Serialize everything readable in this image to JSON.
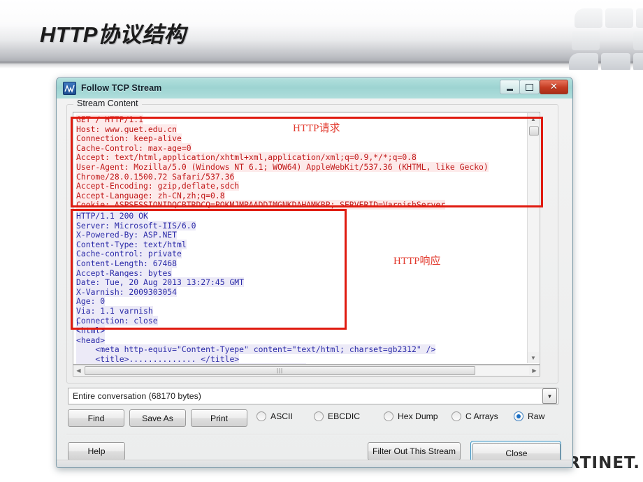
{
  "slide": {
    "title": "HTTP协议结构",
    "watermark": "RTINET."
  },
  "window": {
    "title": "Follow TCP Stream",
    "icon": "wireshark-icon",
    "controls": {
      "minimize": "–",
      "maximize": "□",
      "close": "✕"
    }
  },
  "stream_group": {
    "legend": "Stream Content",
    "scroll": {
      "up_arrow": "▲",
      "down_arrow": "▼",
      "left_arrow": "◀",
      "right_arrow": "▶",
      "grip": "‖‖"
    }
  },
  "request": {
    "lines": "GET / HTTP/1.1\nHost: www.guet.edu.cn\nConnection: keep-alive\nCache-Control: max-age=0\nAccept: text/html,application/xhtml+xml,application/xml;q=0.9,*/*;q=0.8\nUser-Agent: Mozilla/5.0 (Windows NT 6.1; WOW64) AppleWebKit/537.36 (KHTML, like Gecko)\nChrome/28.0.1500.72 Safari/537.36\nAccept-Encoding: gzip,deflate,sdch\nAccept-Language: zh-CN,zh;q=0.8\nCookie: ASPSESSIONIDQCBTRDCQ=POKMJMPAADDIMGNKDAHAMKBP; SERVERID=VarnishServer",
    "annotation": "HTTP请求",
    "color": "#c01717"
  },
  "response": {
    "lines": "HTTP/1.1 200 OK\nServer: Microsoft-IIS/6.0\nX-Powered-By: ASP.NET\nContent-Type: text/html\nCache-control: private\nContent-Length: 67468\nAccept-Ranges: bytes\nDate: Tue, 20 Aug 2013 13:27:45 GMT\nX-Varnish: 2009303054\nAge: 0\nVia: 1.1 varnish\nConnection: close",
    "annotation": "HTTP响应",
    "color": "#2b2ba8"
  },
  "body": {
    "lines": "<html>\n<head>\n    <meta http-equiv=\"Content-Tyepe\" content=\"text/html; charset=gb2312\" />\n    <title>.............. </title>\n    <mmstring:loadstring id=\"insertbar/layer\" />"
  },
  "conversation": {
    "value": "Entire conversation (68170 bytes)",
    "arrow": "▼"
  },
  "actions": {
    "find": "Find",
    "find_mnemonic": "F",
    "save_as": "Save As",
    "print": "Print"
  },
  "formats": [
    {
      "label": "ASCII",
      "selected": false
    },
    {
      "label": "EBCDIC",
      "selected": false
    },
    {
      "label": "Hex Dump",
      "selected": false
    },
    {
      "label": "C Arrays",
      "selected": false
    },
    {
      "label": "Raw",
      "selected": true
    }
  ],
  "footer": {
    "help": "Help",
    "filter_out": "Filter Out This Stream",
    "close": "Close"
  }
}
